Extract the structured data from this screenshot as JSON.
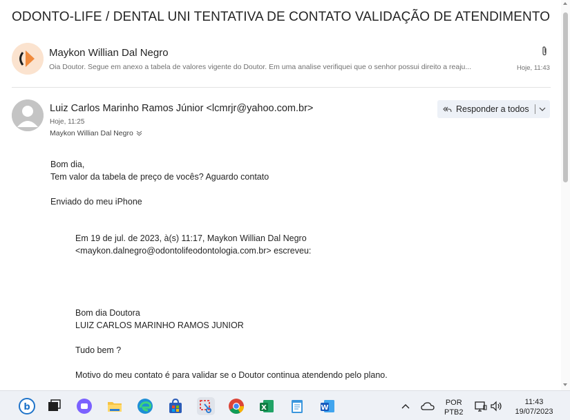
{
  "subject": "ODONTO-LIFE / DENTAL UNI TENTATIVA DE CONTATO VALIDAÇÃO DE ATENDIMENTO",
  "messages": [
    {
      "sender": "Maykon Willian Dal Negro",
      "preview": "Oia Doutor. Segue em anexo a tabela de valores vigente do Doutor. Em uma analise verifiquei que o senhor possui direito a reaju...",
      "time": "Hoje, 11:43",
      "has_attachment": true
    },
    {
      "sender": "Luiz Carlos Marinho Ramos Júnior <lcmrjr@yahoo.com.br>",
      "time": "Hoje, 11:25",
      "to": "Maykon Willian Dal Negro",
      "reply_all_label": "Responder a todos",
      "body_lines": [
        "Bom dia,",
        "Tem valor da tabela de preço de vocês? Aguardo contato",
        "",
        "Enviado do meu iPhone"
      ],
      "quote_lines": [
        "Em 19 de jul. de 2023, à(s) 11:17, Maykon Willian Dal Negro",
        "<maykon.dalnegro@odontolifeodontologia.com.br> escreveu:",
        "",
        "",
        "",
        "",
        "Bom dia Doutora",
        "LUIZ CARLOS MARINHO RAMOS JUNIOR",
        "",
        "Tudo bem ?",
        "",
        "Motivo do meu contato é para validar se o Doutor continua atendendo pelo plano."
      ]
    }
  ],
  "taskbar": {
    "apps": [
      "bing-icon",
      "task-view-icon",
      "teams-icon",
      "file-explorer-icon",
      "edge-icon",
      "store-icon",
      "snipping-tool-icon",
      "chrome-icon",
      "excel-icon",
      "notepad-icon",
      "word-icon"
    ],
    "lang_top": "POR",
    "lang_bottom": "PTB2",
    "clock_time": "11:43",
    "clock_date": "19/07/2023"
  },
  "colors": {
    "accent": "#0f6cbd",
    "reply_button_bg": "#edf1f7",
    "avatar_orange": "#f08a3c"
  }
}
